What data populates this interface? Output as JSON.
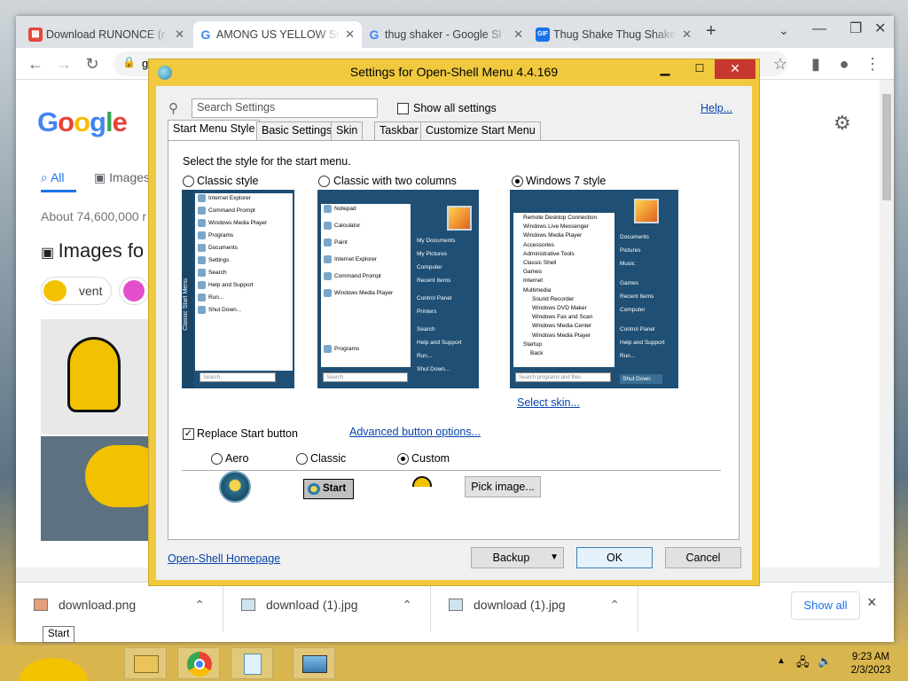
{
  "chrome": {
    "tabs": [
      {
        "title": "Download RUNONCE (r",
        "favicon": "game-icon",
        "color": "#e8453c"
      },
      {
        "title": "AMONG US YELLOW St",
        "favicon": "google-icon",
        "color": "#4285f4"
      },
      {
        "title": "thug shaker - Google Sl",
        "favicon": "google-icon",
        "color": "#4285f4"
      },
      {
        "title": "Thug Shake Thug Shake",
        "favicon": "gif-icon",
        "color": "#1a73e8"
      }
    ],
    "new_tab_label": "+",
    "address_partial": "g",
    "google": {
      "logo": "Google",
      "tab_all": "All",
      "tab_images": "Images",
      "results_count": "About 74,600,000 r",
      "images_heading": "Images fo",
      "chip_vent": "vent"
    },
    "downloads": [
      {
        "name": "download.png"
      },
      {
        "name": "download (1).jpg"
      },
      {
        "name": "download (1).jpg"
      }
    ],
    "show_all_label": "Show all",
    "close_label": "×"
  },
  "dialog": {
    "title": "Settings for Open-Shell Menu 4.4.169",
    "search_placeholder": "Search Settings",
    "show_all_settings": "Show all settings",
    "help_link": "Help...",
    "tabs": [
      "Start Menu Style",
      "Basic Settings",
      "Skin",
      "Taskbar",
      "Customize Start Menu"
    ],
    "active_tab": "Start Menu Style",
    "select_style_label": "Select the style for the start menu.",
    "styles": [
      {
        "label": "Classic style",
        "selected": false
      },
      {
        "label": "Classic with two columns",
        "selected": false
      },
      {
        "label": "Windows 7 style",
        "selected": true
      }
    ],
    "classic_preview": {
      "items": [
        "Internet Explorer",
        "Command Prompt",
        "Windows Media Player",
        "Programs",
        "Documents",
        "Settings",
        "Search",
        "Help and Support",
        "Run...",
        "Shut Down..."
      ],
      "search": "Search",
      "vertical_text": "Classic Start Menu"
    },
    "two_col_preview": {
      "left": [
        "Notepad",
        "Calculator",
        "Paint",
        "Internet Explorer",
        "Command Prompt",
        "Windows Media Player"
      ],
      "programs": "Programs",
      "right": [
        "My Documents",
        "My Pictures",
        "Computer",
        "Recent Items",
        "Control Panel",
        "Printers",
        "Search",
        "Help and Support",
        "Run...",
        "Shut Down..."
      ],
      "search": "Search"
    },
    "win7_preview": {
      "left": [
        "Remote Desktop Connection",
        "Windows Live Messenger",
        "Windows Media Player",
        "Accessories",
        "Administrative Tools",
        "Classic Shell",
        "Games",
        "Internet",
        "Multimedia",
        "Sound Recorder",
        "Windows DVD Maker",
        "Windows Fax and Scan",
        "Windows Media Center",
        "Windows Media Player",
        "Startup",
        "Back"
      ],
      "right": [
        "Documents",
        "Pictures",
        "Music",
        "Games",
        "Recent Items",
        "Computer",
        "Control Panel",
        "Help and Support",
        "Run..."
      ],
      "search": "Search programs and files",
      "shutdown": "Shut Down"
    },
    "select_skin_link": "Select skin...",
    "replace_start_button": "Replace Start button",
    "replace_checked": true,
    "advanced_button_link": "Advanced button options...",
    "button_styles": [
      {
        "label": "Aero",
        "selected": false
      },
      {
        "label": "Classic",
        "selected": false
      },
      {
        "label": "Custom",
        "selected": true
      }
    ],
    "classic_button_text": "Start",
    "pick_image": "Pick image...",
    "homepage_link": "Open-Shell Homepage",
    "backup": "Backup",
    "ok": "OK",
    "cancel": "Cancel"
  },
  "taskbar": {
    "time": "9:23 AM",
    "date": "2/3/2023",
    "start_tooltip": "Start",
    "icons": [
      "file-explorer-icon",
      "chrome-icon",
      "notepad-icon",
      "image-viewer-icon"
    ]
  }
}
